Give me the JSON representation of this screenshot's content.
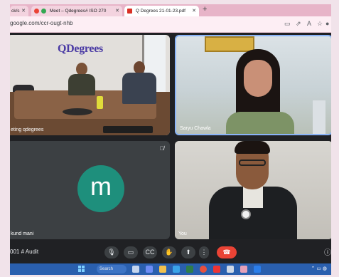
{
  "browser": {
    "tabs": [
      {
        "label": "ck/s"
      },
      {
        "label": "Meet – Qdegrees# ISO 270"
      },
      {
        "label": "Q Degrees 21-01-23.pdf"
      }
    ],
    "new_tab": "+",
    "url": "google.com/ccr-ougt-nhb"
  },
  "meet": {
    "tiles": [
      {
        "label": "eting qdegrees",
        "logo": "QDegrees"
      },
      {
        "label": "Saryu Chawla"
      },
      {
        "label": "kund mani",
        "avatar_letter": "m"
      },
      {
        "label": "You"
      }
    ],
    "meeting_code": "001 # Audit"
  },
  "taskbar": {
    "search_label": "Search"
  },
  "colors": {
    "page_bg": "#f1e3ea",
    "tab_strip": "#e7b4c8",
    "meet_bg": "#202124",
    "avatar": "#1e8f7c",
    "end_call": "#ea4335",
    "active_speaker_border": "#8ab4f8",
    "taskbar": "#2a5fae"
  },
  "icons": [
    "mic-icon",
    "camera-icon",
    "captions-icon",
    "raise-hand-icon",
    "present-icon",
    "more-icon",
    "end-call-icon",
    "info-icon",
    "mic-off-icon"
  ]
}
